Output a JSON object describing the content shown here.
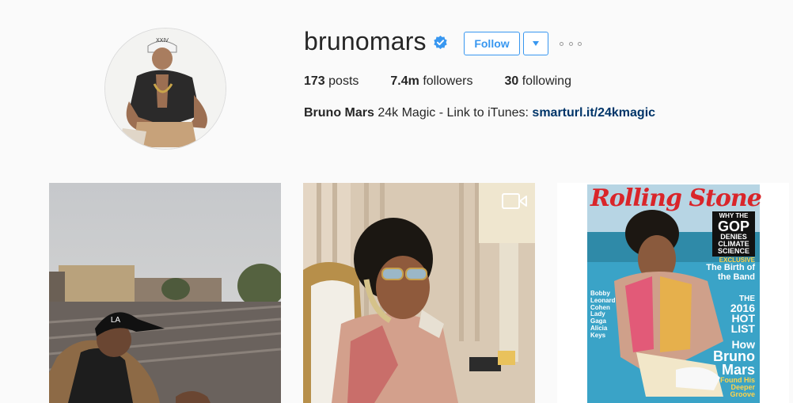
{
  "profile": {
    "username": "brunomars",
    "verified": true,
    "follow_label": "Follow",
    "dropdown_icon": "caret-down-icon",
    "more_icon": "ellipsis-icon"
  },
  "stats": {
    "posts_count": "173",
    "posts_label": "posts",
    "followers_count": "7.4m",
    "followers_label": "followers",
    "following_count": "30",
    "following_label": "following"
  },
  "bio": {
    "full_name": "Bruno Mars",
    "text": "24k Magic - Link to iTunes:",
    "link": "smarturl.it/24kmagic"
  },
  "posts": [
    {
      "type": "photo"
    },
    {
      "type": "video"
    },
    {
      "type": "photo"
    }
  ],
  "magazine": {
    "masthead": "Rolling Stone",
    "top_right": [
      "WHY THE",
      "GOP",
      "DENIES",
      "CLIMATE",
      "SCIENCE"
    ],
    "exclusive": [
      "EXCLUSIVE",
      "The Birth of",
      "the Band"
    ],
    "list": [
      "THE",
      "2016",
      "HOT",
      "LIST"
    ],
    "left_names": [
      "Bobby",
      "Leonard",
      "Cohen",
      "Lady",
      "Gaga",
      "Alicia",
      "Keys"
    ],
    "cover_line": [
      "How",
      "Bruno",
      "Mars",
      "Found His",
      "Deeper",
      "Groove"
    ]
  },
  "colors": {
    "accent": "#3897f0",
    "link": "#003569",
    "background": "#fafafa"
  }
}
